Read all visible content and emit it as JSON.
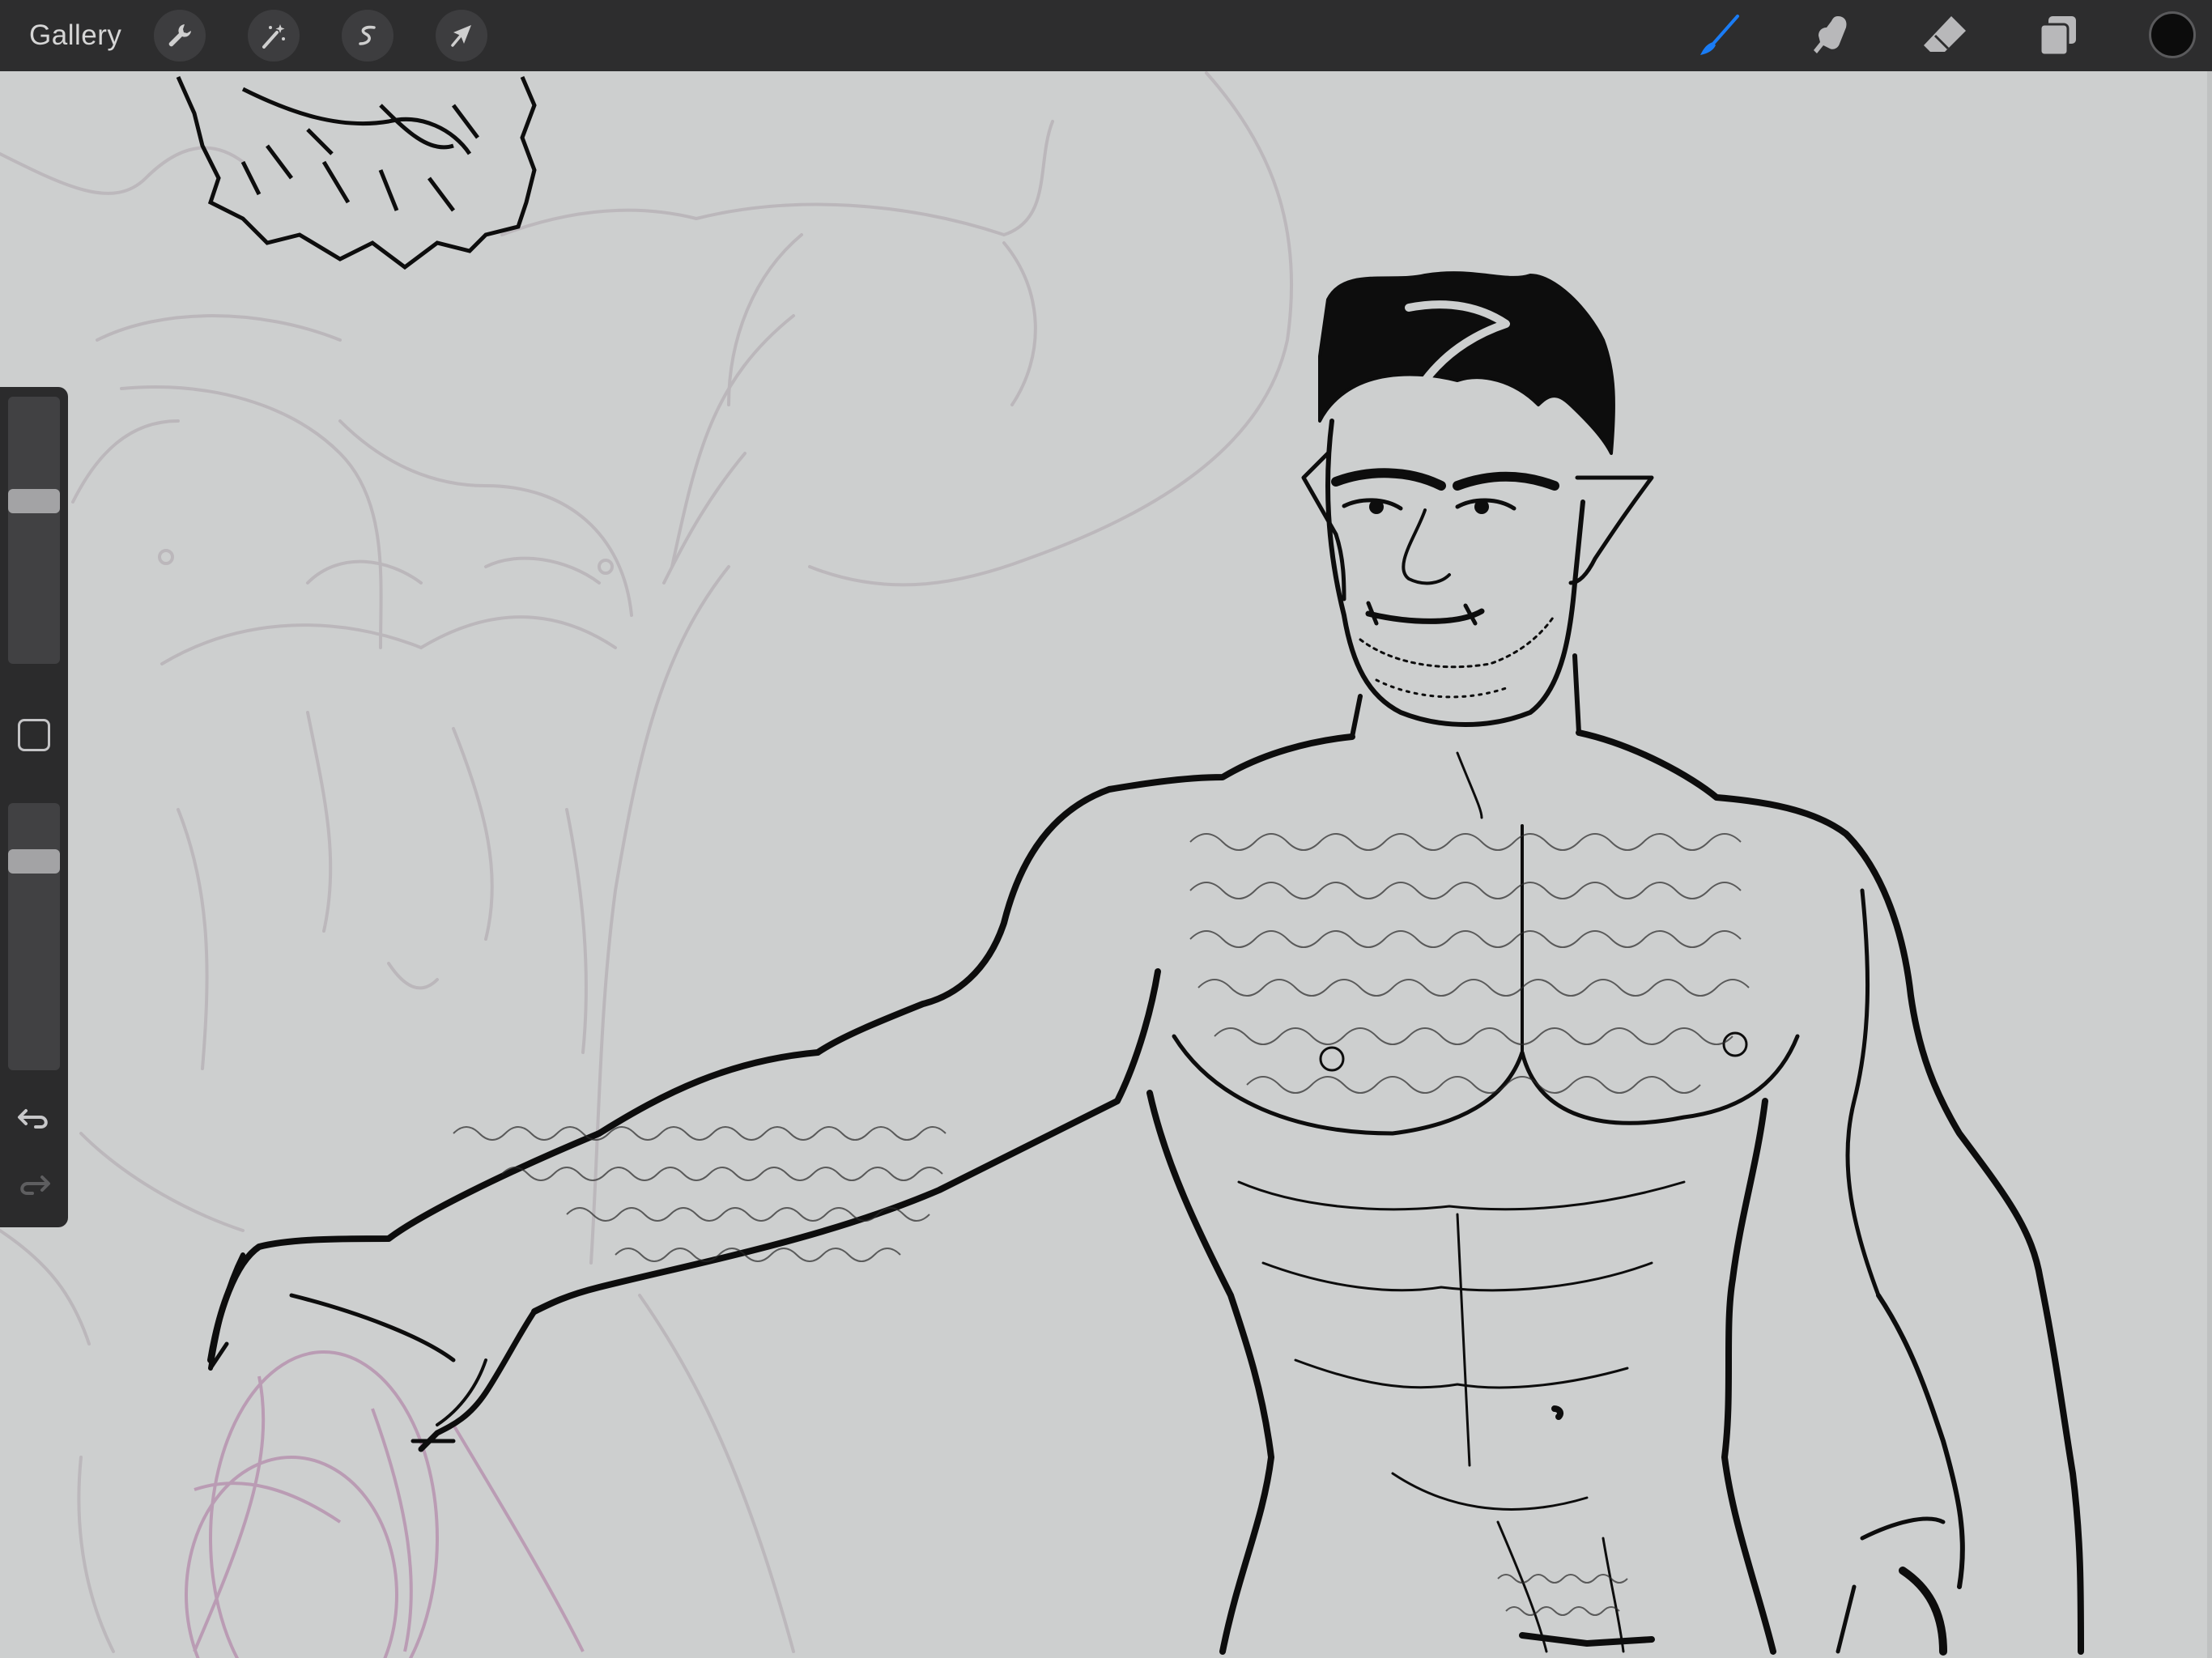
{
  "topbar": {
    "gallery_label": "Gallery",
    "left_tools": [
      {
        "name": "actions",
        "icon": "wrench-icon"
      },
      {
        "name": "adjustments",
        "icon": "magic-wand-icon"
      },
      {
        "name": "selection",
        "icon": "selection-s-icon"
      },
      {
        "name": "transform",
        "icon": "arrow-cursor-icon"
      }
    ],
    "right_tools": [
      {
        "name": "brush",
        "icon": "brush-icon",
        "active": true,
        "color": "#1a7cf5"
      },
      {
        "name": "smudge",
        "icon": "smudge-finger-icon",
        "active": false
      },
      {
        "name": "eraser",
        "icon": "eraser-icon",
        "active": false
      },
      {
        "name": "layers",
        "icon": "layers-icon",
        "active": false
      }
    ],
    "current_color": "#0c0c0c"
  },
  "sidebar": {
    "brush_size_level": 0.38,
    "brush_opacity_level": 0.19,
    "modify_button_icon": "square-icon",
    "undo_icon": "undo-arrow-icon",
    "redo_icon": "redo-arrow-icon"
  },
  "colors": {
    "toolbar_bg": "#2d2d2e",
    "canvas_bg": "#cdcfcf",
    "active_tool": "#1a7cf5",
    "sketch_line": "#bcb7bb",
    "sketch_pink": "#b48cab",
    "ink": "#0d0d0d"
  }
}
